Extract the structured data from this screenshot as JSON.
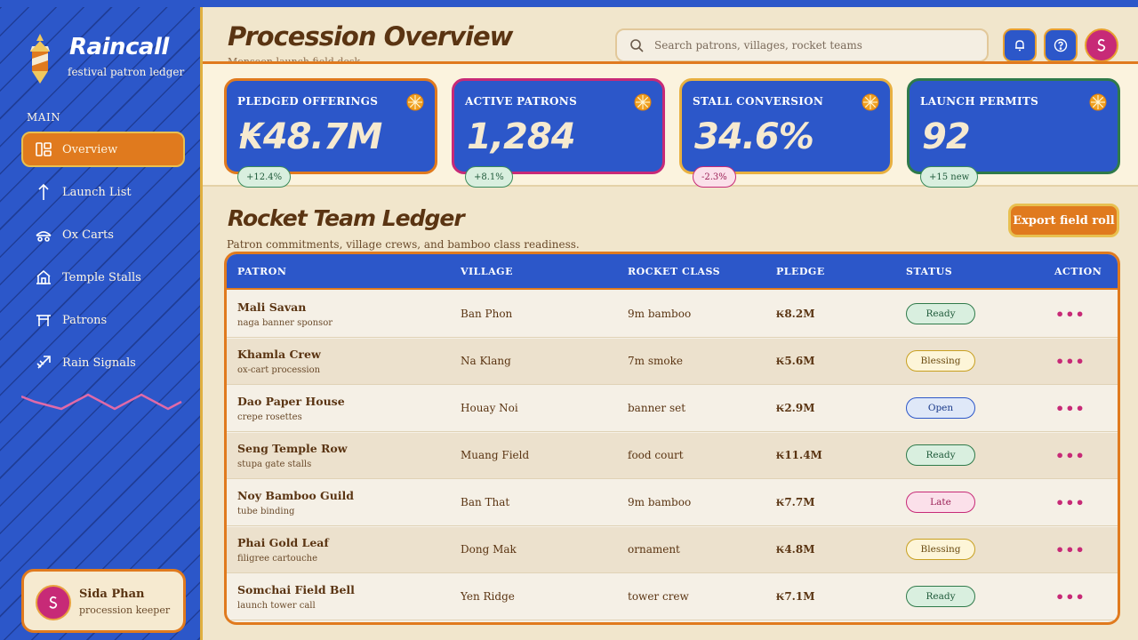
{
  "brand": {
    "name": "Raincall",
    "subtitle": "festival patron ledger"
  },
  "sidebar": {
    "section_label": "MAIN",
    "items": [
      {
        "label": "Overview",
        "icon": "overview-icon",
        "active": true
      },
      {
        "label": "Launch List",
        "icon": "launch-arrow-icon",
        "active": false
      },
      {
        "label": "Ox Carts",
        "icon": "ox-cart-icon",
        "active": false
      },
      {
        "label": "Temple Stalls",
        "icon": "temple-icon",
        "active": false
      },
      {
        "label": "Patrons",
        "icon": "torii-gate-icon",
        "active": false
      },
      {
        "label": "Rain Signals",
        "icon": "rocket-signal-icon",
        "active": false
      }
    ]
  },
  "user": {
    "name": "Sida Phan",
    "role": "procession keeper",
    "initial": "S"
  },
  "header": {
    "title": "Procession Overview",
    "subtitle": "Monsoon launch field desk",
    "search_placeholder": "Search patrons, villages, rocket teams",
    "avatar_initial": "S"
  },
  "kpis": [
    {
      "label": "PLEDGED OFFERINGS",
      "value": "₭48.7M",
      "badge": "+12.4%",
      "trend": "up",
      "border": "#e07a1e"
    },
    {
      "label": "ACTIVE PATRONS",
      "value": "1,284",
      "badge": "+8.1%",
      "trend": "up",
      "border": "#c72a77"
    },
    {
      "label": "STALL CONVERSION",
      "value": "34.6%",
      "badge": "-2.3%",
      "trend": "down",
      "border": "#e8b040"
    },
    {
      "label": "LAUNCH PERMITS",
      "value": "92",
      "badge": "+15 new",
      "trend": "up",
      "border": "#2f7a4a"
    }
  ],
  "ledger": {
    "title": "Rocket Team Ledger",
    "subtitle": "Patron commitments, village crews, and bamboo class readiness.",
    "export_label": "Export field roll",
    "columns": [
      "PATRON",
      "VILLAGE",
      "ROCKET CLASS",
      "PLEDGE",
      "STATUS",
      "ACTION"
    ],
    "rows": [
      {
        "name": "Mali Savan",
        "note": "naga banner sponsor",
        "village": "Ban Phon",
        "class": "9m bamboo",
        "pledge": "₭8.2M",
        "status": "Ready"
      },
      {
        "name": "Khamla Crew",
        "note": "ox-cart procession",
        "village": "Na Klang",
        "class": "7m smoke",
        "pledge": "₭5.6M",
        "status": "Blessing"
      },
      {
        "name": "Dao Paper House",
        "note": "crepe rosettes",
        "village": "Houay Noi",
        "class": "banner set",
        "pledge": "₭2.9M",
        "status": "Open"
      },
      {
        "name": "Seng Temple Row",
        "note": "stupa gate stalls",
        "village": "Muang Field",
        "class": "food court",
        "pledge": "₭11.4M",
        "status": "Ready"
      },
      {
        "name": "Noy Bamboo Guild",
        "note": "tube binding",
        "village": "Ban That",
        "class": "9m bamboo",
        "pledge": "₭7.7M",
        "status": "Late"
      },
      {
        "name": "Phai Gold Leaf",
        "note": "filigree cartouche",
        "village": "Dong Mak",
        "class": "ornament",
        "pledge": "₭4.8M",
        "status": "Blessing"
      },
      {
        "name": "Somchai Field Bell",
        "note": "launch tower call",
        "village": "Yen Ridge",
        "class": "tower crew",
        "pledge": "₭7.1M",
        "status": "Ready"
      }
    ],
    "action_glyph": "•••"
  },
  "colors": {
    "primary_blue": "#2c57c9",
    "accent_orange": "#e07a1e",
    "accent_magenta": "#c72a77",
    "cream": "#f1e6cc",
    "brown_text": "#5a3412"
  }
}
